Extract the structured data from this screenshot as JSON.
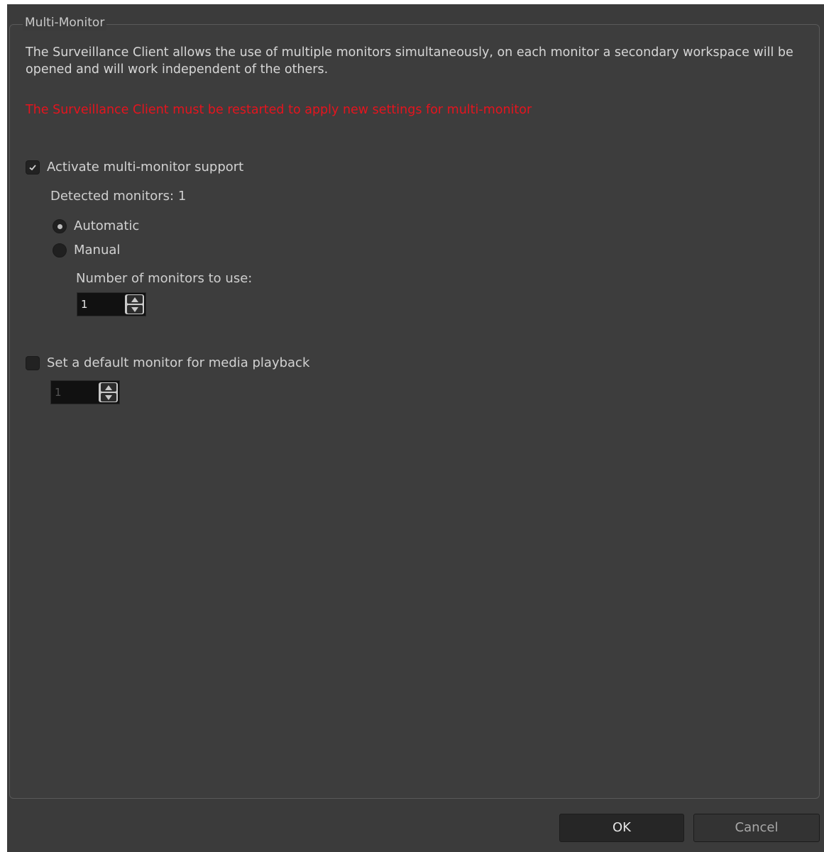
{
  "group": {
    "title": "Multi-Monitor"
  },
  "description": "The Surveillance Client allows the use of multiple monitors simultaneously, on each monitor a secondary workspace will be opened and will work independent of the others.",
  "warning": {
    "text": "The Surveillance Client must be restarted to apply new settings for multi-monitor",
    "color": "#e5141e"
  },
  "activate": {
    "label": "Activate multi-monitor support",
    "checked": true
  },
  "detected": {
    "label": "Detected monitors: 1"
  },
  "mode": {
    "automatic_label": "Automatic",
    "manual_label": "Manual",
    "selected": "Automatic"
  },
  "monitors_to_use": {
    "label": "Number of monitors to use:",
    "value": "1"
  },
  "default_monitor": {
    "label": "Set a default monitor for media playback",
    "checked": false,
    "value": "1",
    "enabled": false
  },
  "buttons": {
    "ok_label": "OK",
    "cancel_label": "Cancel"
  },
  "icons": {
    "check": "check-icon",
    "spin_up": "arrow-up-icon",
    "spin_down": "arrow-down-icon"
  }
}
